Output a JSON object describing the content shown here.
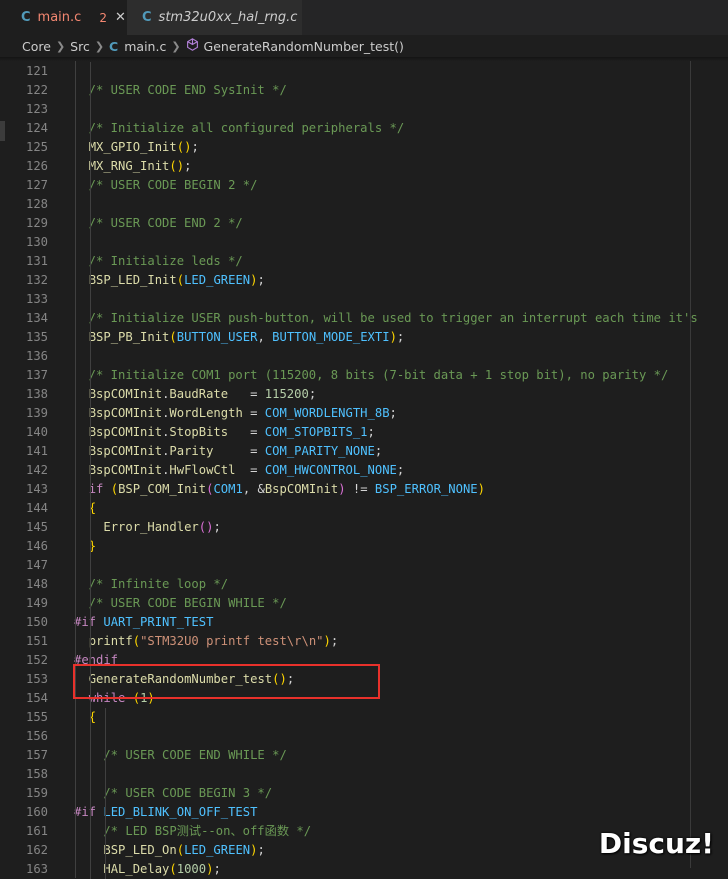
{
  "tabs": [
    {
      "icon": "c-file-icon",
      "glyph": "C",
      "name": "main.c",
      "modified_count": "2",
      "close": "✕"
    },
    {
      "icon": "c-file-icon",
      "glyph": "C",
      "name": "stm32u0xx_hal_rng.c"
    }
  ],
  "breadcrumb": {
    "segments": [
      "Core",
      "Src",
      "main.c",
      "GenerateRandomNumber_test()"
    ],
    "file_glyph": "C",
    "symbol_icon": "cube-method-icon"
  },
  "code_lines": [
    {
      "n": "121",
      "tokens": []
    },
    {
      "n": "122",
      "tokens": [
        [
          "cm",
          "  /* USER CODE END SysInit */"
        ]
      ]
    },
    {
      "n": "123",
      "tokens": []
    },
    {
      "n": "124",
      "tokens": [
        [
          "cm",
          "  /* Initialize all configured peripherals */"
        ]
      ]
    },
    {
      "n": "125",
      "tokens": [
        [
          "",
          "  "
        ],
        [
          "mac",
          "MX_GPIO_Init"
        ],
        [
          "p1",
          "()"
        ],
        [
          "",
          ";"
        ]
      ]
    },
    {
      "n": "126",
      "tokens": [
        [
          "",
          "  "
        ],
        [
          "mac",
          "MX_RNG_Init"
        ],
        [
          "p1",
          "()"
        ],
        [
          "",
          ";"
        ]
      ]
    },
    {
      "n": "127",
      "tokens": [
        [
          "cm",
          "  /* USER CODE BEGIN 2 */"
        ]
      ]
    },
    {
      "n": "128",
      "tokens": []
    },
    {
      "n": "129",
      "tokens": [
        [
          "cm",
          "  /* USER CODE END 2 */"
        ]
      ]
    },
    {
      "n": "130",
      "tokens": []
    },
    {
      "n": "131",
      "tokens": [
        [
          "cm",
          "  /* Initialize leds */"
        ]
      ]
    },
    {
      "n": "132",
      "tokens": [
        [
          "",
          "  "
        ],
        [
          "mac",
          "BSP_LED_Init"
        ],
        [
          "p1",
          "("
        ],
        [
          "cst",
          "LED_GREEN"
        ],
        [
          "p1",
          ")"
        ],
        [
          "",
          ";"
        ]
      ]
    },
    {
      "n": "133",
      "tokens": []
    },
    {
      "n": "134",
      "tokens": [
        [
          "cm",
          "  /* Initialize USER push-button, will be used to trigger an interrupt each time it's"
        ]
      ]
    },
    {
      "n": "135",
      "tokens": [
        [
          "",
          "  "
        ],
        [
          "mac",
          "BSP_PB_Init"
        ],
        [
          "p1",
          "("
        ],
        [
          "cst",
          "BUTTON_USER"
        ],
        [
          "",
          ", "
        ],
        [
          "cst",
          "BUTTON_MODE_EXTI"
        ],
        [
          "p1",
          ")"
        ],
        [
          "",
          ";"
        ]
      ]
    },
    {
      "n": "136",
      "tokens": []
    },
    {
      "n": "137",
      "tokens": [
        [
          "cm",
          "  /* Initialize COM1 port (115200, 8 bits (7-bit data + 1 stop bit), no parity */"
        ]
      ]
    },
    {
      "n": "138",
      "tokens": [
        [
          "",
          "  "
        ],
        [
          "mac",
          "BspCOMInit"
        ],
        [
          "",
          "."
        ],
        [
          "mac",
          "BaudRate"
        ],
        [
          "",
          "   = "
        ],
        [
          "num",
          "115200"
        ],
        [
          "",
          ";"
        ]
      ]
    },
    {
      "n": "139",
      "tokens": [
        [
          "",
          "  "
        ],
        [
          "mac",
          "BspCOMInit"
        ],
        [
          "",
          "."
        ],
        [
          "mac",
          "WordLength"
        ],
        [
          "",
          " = "
        ],
        [
          "cst",
          "COM_WORDLENGTH_8B"
        ],
        [
          "",
          ";"
        ]
      ]
    },
    {
      "n": "140",
      "tokens": [
        [
          "",
          "  "
        ],
        [
          "mac",
          "BspCOMInit"
        ],
        [
          "",
          "."
        ],
        [
          "mac",
          "StopBits"
        ],
        [
          "",
          "   = "
        ],
        [
          "cst",
          "COM_STOPBITS_1"
        ],
        [
          "",
          ";"
        ]
      ]
    },
    {
      "n": "141",
      "tokens": [
        [
          "",
          "  "
        ],
        [
          "mac",
          "BspCOMInit"
        ],
        [
          "",
          "."
        ],
        [
          "mac",
          "Parity"
        ],
        [
          "",
          "     = "
        ],
        [
          "cst",
          "COM_PARITY_NONE"
        ],
        [
          "",
          ";"
        ]
      ]
    },
    {
      "n": "142",
      "tokens": [
        [
          "",
          "  "
        ],
        [
          "mac",
          "BspCOMInit"
        ],
        [
          "",
          "."
        ],
        [
          "mac",
          "HwFlowCtl"
        ],
        [
          "",
          "  = "
        ],
        [
          "cst",
          "COM_HWCONTROL_NONE"
        ],
        [
          "",
          ";"
        ]
      ]
    },
    {
      "n": "143",
      "tokens": [
        [
          "",
          "  "
        ],
        [
          "kwc",
          "if"
        ],
        [
          "",
          " "
        ],
        [
          "p1",
          "("
        ],
        [
          "mac",
          "BSP_COM_Init"
        ],
        [
          "p2",
          "("
        ],
        [
          "cst",
          "COM1"
        ],
        [
          "",
          ", &"
        ],
        [
          "mac",
          "BspCOMInit"
        ],
        [
          "p2",
          ")"
        ],
        [
          "",
          " != "
        ],
        [
          "cst",
          "BSP_ERROR_NONE"
        ],
        [
          "p1",
          ")"
        ]
      ]
    },
    {
      "n": "144",
      "tokens": [
        [
          "",
          "  "
        ],
        [
          "p1",
          "{"
        ]
      ]
    },
    {
      "n": "145",
      "tokens": [
        [
          "",
          "    "
        ],
        [
          "mac",
          "Error_Handler"
        ],
        [
          "p2",
          "()"
        ],
        [
          "",
          ";"
        ]
      ]
    },
    {
      "n": "146",
      "tokens": [
        [
          "",
          "  "
        ],
        [
          "p1",
          "}"
        ]
      ]
    },
    {
      "n": "147",
      "tokens": []
    },
    {
      "n": "148",
      "tokens": [
        [
          "cm",
          "  /* Infinite loop */"
        ]
      ]
    },
    {
      "n": "149",
      "tokens": [
        [
          "cm",
          "  /* USER CODE BEGIN WHILE */"
        ]
      ]
    },
    {
      "n": "150",
      "tokens": [
        [
          "pp",
          "#if"
        ],
        [
          "",
          " "
        ],
        [
          "cst",
          "UART_PRINT_TEST"
        ]
      ]
    },
    {
      "n": "151",
      "tokens": [
        [
          "",
          "  "
        ],
        [
          "mac",
          "printf"
        ],
        [
          "p1",
          "("
        ],
        [
          "str",
          "\"STM32U0 printf test\\r\\n\""
        ],
        [
          "p1",
          ")"
        ],
        [
          "",
          ";"
        ]
      ]
    },
    {
      "n": "152",
      "tokens": [
        [
          "pp",
          "#endif"
        ]
      ]
    },
    {
      "n": "153",
      "tokens": [
        [
          "",
          "  "
        ],
        [
          "mac",
          "GenerateRandomNumber_test"
        ],
        [
          "p1",
          "()"
        ],
        [
          "",
          ";"
        ]
      ]
    },
    {
      "n": "154",
      "tokens": [
        [
          "",
          "  "
        ],
        [
          "kwc",
          "while"
        ],
        [
          "",
          " "
        ],
        [
          "p1",
          "("
        ],
        [
          "num",
          "1"
        ],
        [
          "p1",
          ")"
        ]
      ]
    },
    {
      "n": "155",
      "tokens": [
        [
          "",
          "  "
        ],
        [
          "p1",
          "{"
        ]
      ]
    },
    {
      "n": "156",
      "tokens": []
    },
    {
      "n": "157",
      "tokens": [
        [
          "cm",
          "    /* USER CODE END WHILE */"
        ]
      ]
    },
    {
      "n": "158",
      "tokens": []
    },
    {
      "n": "159",
      "tokens": [
        [
          "cm",
          "    /* USER CODE BEGIN 3 */"
        ]
      ]
    },
    {
      "n": "160",
      "tokens": [
        [
          "pp",
          "#if"
        ],
        [
          "",
          " "
        ],
        [
          "cst",
          "LED_BLINK_ON_OFF_TEST"
        ]
      ]
    },
    {
      "n": "161",
      "tokens": [
        [
          "cm",
          "    /* LED BSP测试--on、off函数 */"
        ]
      ]
    },
    {
      "n": "162",
      "tokens": [
        [
          "",
          "    "
        ],
        [
          "mac",
          "BSP_LED_On"
        ],
        [
          "p1",
          "("
        ],
        [
          "cst",
          "LED_GREEN"
        ],
        [
          "p1",
          ")"
        ],
        [
          "",
          ";"
        ]
      ]
    },
    {
      "n": "163",
      "tokens": [
        [
          "",
          "    "
        ],
        [
          "mac",
          "HAL_Delay"
        ],
        [
          "p1",
          "("
        ],
        [
          "num",
          "1000"
        ],
        [
          "p1",
          ")"
        ],
        [
          "",
          ";"
        ]
      ]
    }
  ],
  "watermark": "Discuz!"
}
